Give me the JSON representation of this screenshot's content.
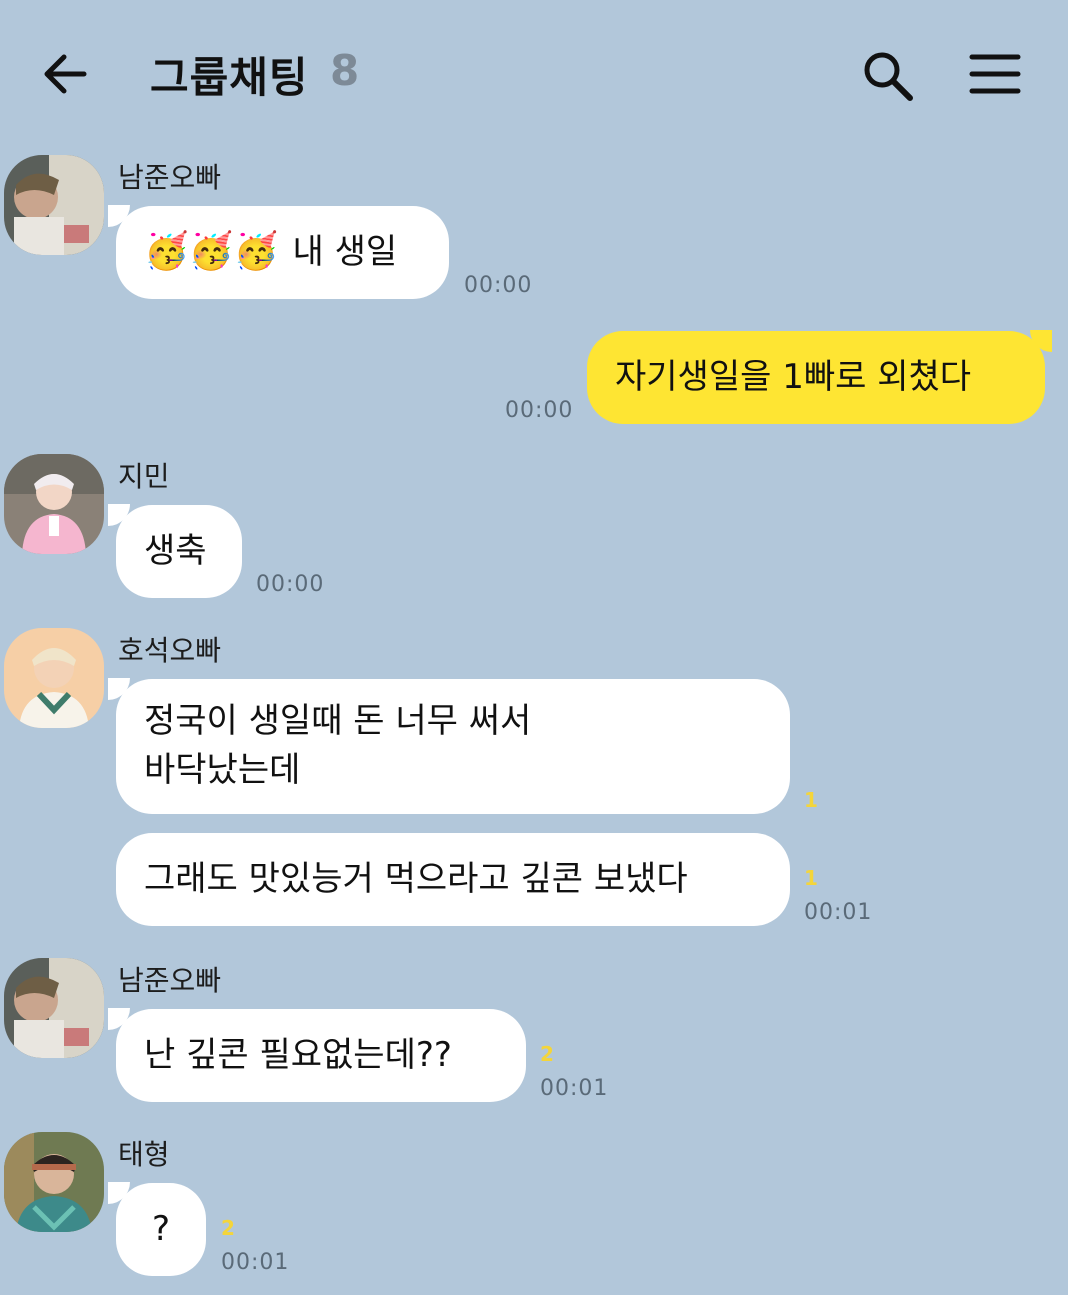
{
  "header": {
    "back_icon": "arrow-left-icon",
    "title": "그룹채팅",
    "member_count": "8",
    "search_icon": "search-icon",
    "menu_icon": "hamburger-menu-icon"
  },
  "colors": {
    "background": "#b2c7da",
    "my_bubble": "#fee533",
    "other_bubble": "#ffffff",
    "unread": "#f4d53a"
  },
  "messages": [
    {
      "sender": "남준오빠",
      "emoji": "🥳🥳🥳",
      "text": "내 생일",
      "time": "00:00"
    },
    {
      "sender": "me",
      "text": "자기생일을 1빠로 외쳤다",
      "time": "00:00"
    },
    {
      "sender": "지민",
      "text": "생축",
      "time": "00:00"
    },
    {
      "sender": "호석오빠",
      "lines": [
        "정국이 생일때 돈 너무 써서",
        "바닥났는데"
      ],
      "unread": "1"
    },
    {
      "sender": "호석오빠",
      "text": "그래도 맛있능거 먹으라고 깊콘 보냈다",
      "unread": "1",
      "time": "00:01"
    },
    {
      "sender": "남준오빠",
      "text": "난 깊콘 필요없는데??",
      "unread": "2",
      "time": "00:01"
    },
    {
      "sender": "태형",
      "text": "?",
      "unread": "2",
      "time": "00:01"
    }
  ]
}
